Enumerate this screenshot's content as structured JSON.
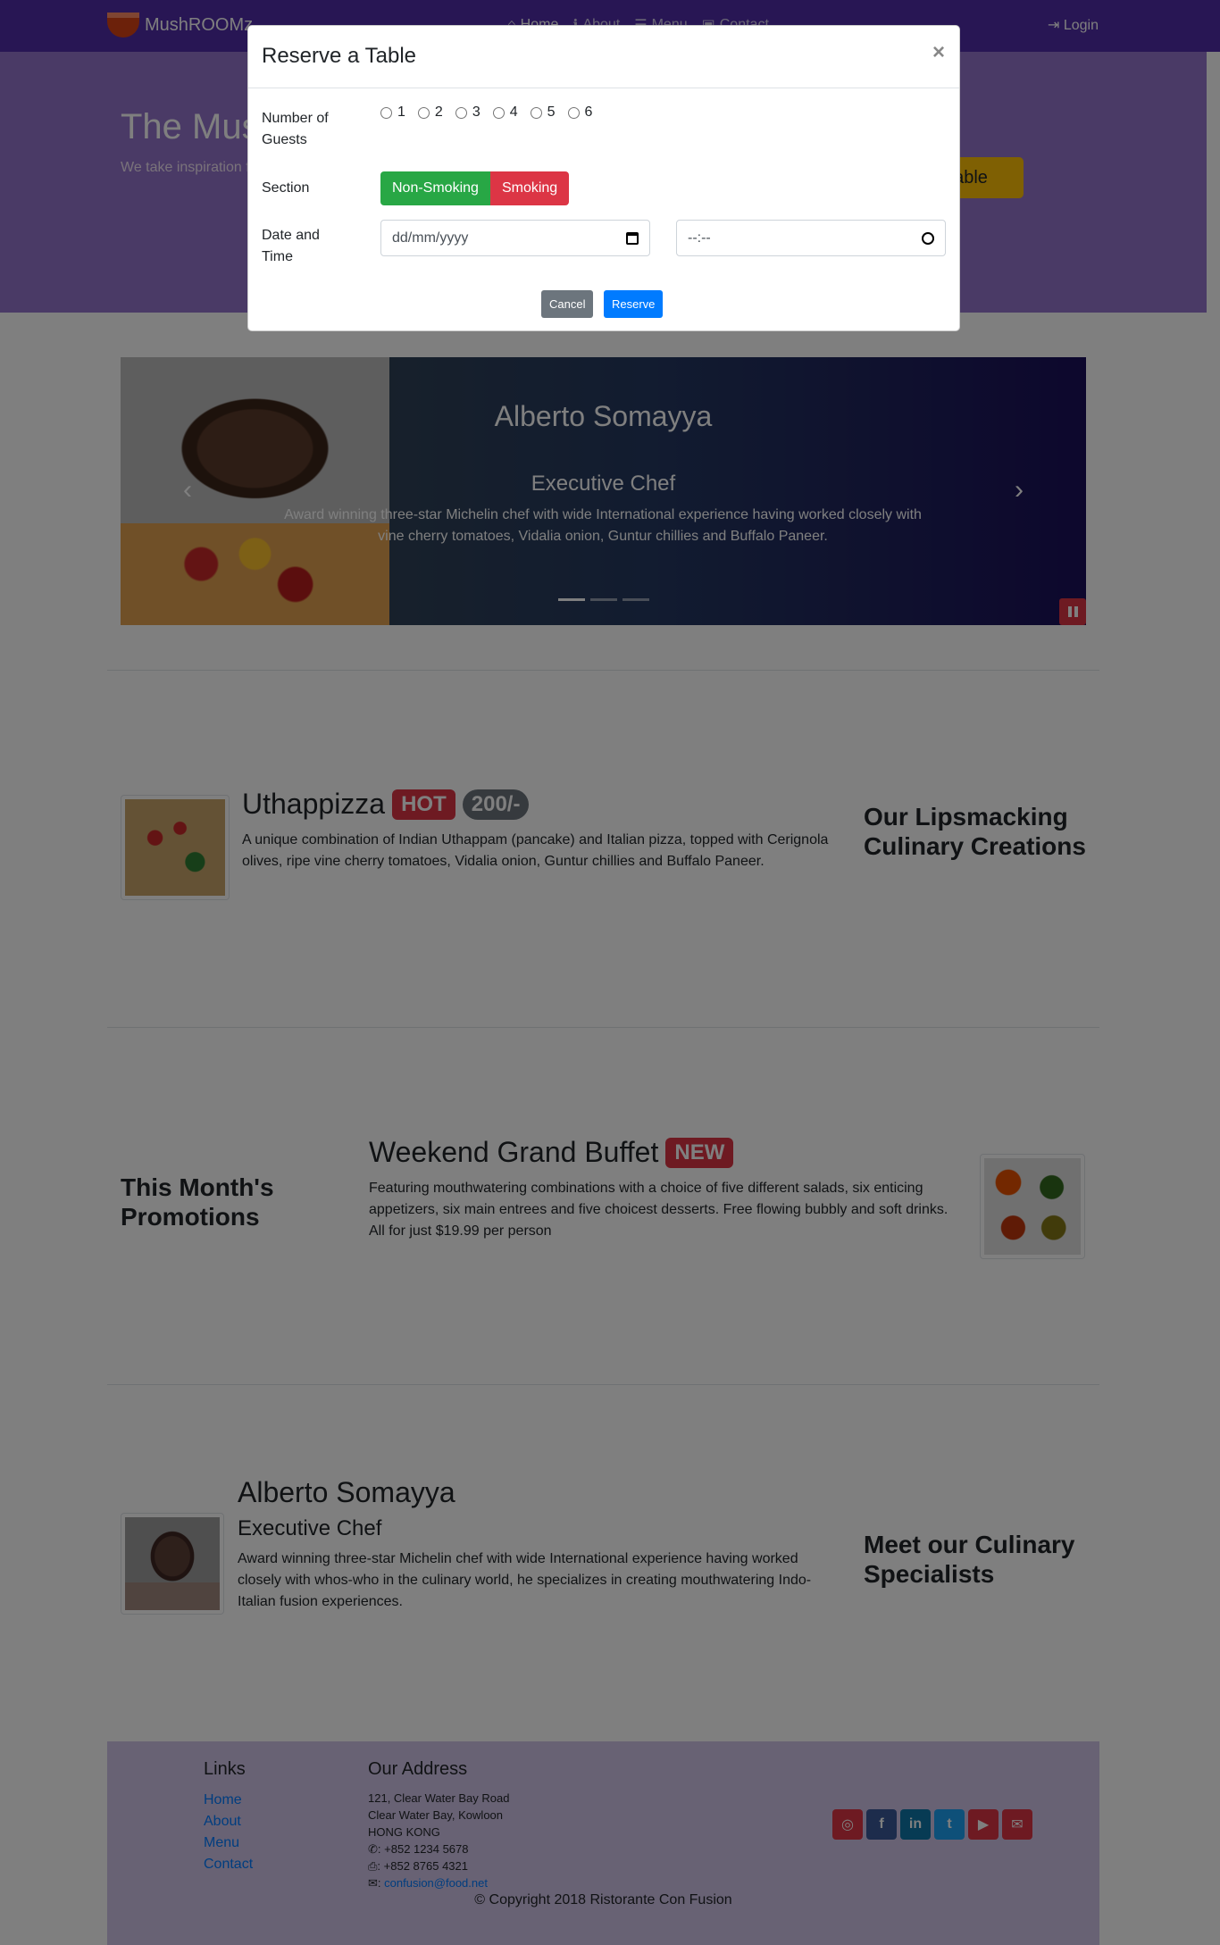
{
  "navbar": {
    "brand": "MushROOMz",
    "links": [
      "Home",
      "About",
      "Menu",
      "Contact"
    ],
    "login": "Login"
  },
  "jumbotron": {
    "title": "The Mus",
    "text": "We take inspiration fusion experience. C senses!",
    "reserve_button": "Table"
  },
  "carousel": {
    "title": "Alberto Somayya",
    "subtitle": "Executive Chef",
    "description": "Award winning three-star Michelin chef with wide International experience having worked closely with vine cherry tomatoes, Vidalia onion, Guntur chillies and Buffalo Paneer."
  },
  "dish": {
    "name": "Uthappizza",
    "label": "HOT",
    "price": "200/-",
    "description": "A unique combination of Indian Uthappam (pancake) and Italian pizza, topped with Cerignola olives, ripe vine cherry tomatoes, Vidalia onion, Guntur chillies and Buffalo Paneer.",
    "side_heading": "Our Lipsmacking Culinary Creations"
  },
  "promotion": {
    "side_heading": "This Month's Promotions",
    "name": "Weekend Grand Buffet",
    "label": "NEW",
    "description": "Featuring mouthwatering combinations with a choice of five different salads, six enticing appetizers, six main entrees and five choicest desserts. Free flowing bubbly and soft drinks. All for just $19.99 per person"
  },
  "leader": {
    "name": "Alberto Somayya",
    "designation": "Executive Chef",
    "description": "Award winning three-star Michelin chef with wide International experience having worked closely with whos-who in the culinary world, he specializes in creating mouthwatering Indo-Italian fusion experiences.",
    "side_heading": "Meet our Culinary Specialists"
  },
  "footer": {
    "links_heading": "Links",
    "links": [
      "Home",
      "About",
      "Menu",
      "Contact"
    ],
    "address_heading": "Our Address",
    "address_lines": [
      "121, Clear Water Bay Road",
      "Clear Water Bay, Kowloon",
      "HONG KONG"
    ],
    "phone": "+852 1234 5678",
    "fax": "+852 8765 4321",
    "email": "confusion@food.net",
    "copyright": "© Copyright 2018 Ristorante Con Fusion",
    "social_colors": [
      "#dc3545",
      "#3b5998",
      "#0e76a8",
      "#1da1f2",
      "#dc3545",
      "#dc3545"
    ]
  },
  "modal": {
    "title": "Reserve a Table",
    "close": "×",
    "guests_label": "Number of Guests",
    "guest_options": [
      "1",
      "2",
      "3",
      "4",
      "5",
      "6"
    ],
    "section_label": "Section",
    "section_options": [
      "Non-Smoking",
      "Smoking"
    ],
    "datetime_label": "Date and Time",
    "date_placeholder": "dd/mm/yyyy",
    "time_placeholder": "--:--",
    "cancel": "Cancel",
    "reserve": "Reserve"
  },
  "colors": {
    "primary": "#512da8",
    "jumbotron": "#9575cd",
    "footer": "#d1c4e9",
    "success": "#28a745",
    "danger": "#dc3545",
    "link": "#007bff"
  }
}
